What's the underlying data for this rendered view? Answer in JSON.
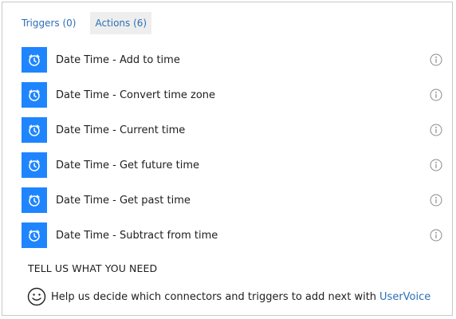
{
  "tabs": [
    {
      "label": "Triggers (0)",
      "active": false
    },
    {
      "label": "Actions (6)",
      "active": true
    }
  ],
  "actions": [
    {
      "label": "Date Time - Add to time",
      "icon": "alarm-clock-icon"
    },
    {
      "label": "Date Time - Convert time zone",
      "icon": "alarm-clock-icon"
    },
    {
      "label": "Date Time - Current time",
      "icon": "alarm-clock-icon"
    },
    {
      "label": "Date Time - Get future time",
      "icon": "alarm-clock-icon"
    },
    {
      "label": "Date Time - Get past time",
      "icon": "alarm-clock-icon"
    },
    {
      "label": "Date Time - Subtract from time",
      "icon": "alarm-clock-icon"
    }
  ],
  "need": {
    "heading": "TELL US WHAT YOU NEED",
    "message": "Help us decide which connectors and triggers to add next with",
    "link_label": "UserVoice"
  },
  "colors": {
    "accent": "#1f85ff",
    "link": "#2b6fb7",
    "active_tab_bg": "#eeeeee",
    "border": "#c8c8c8"
  }
}
